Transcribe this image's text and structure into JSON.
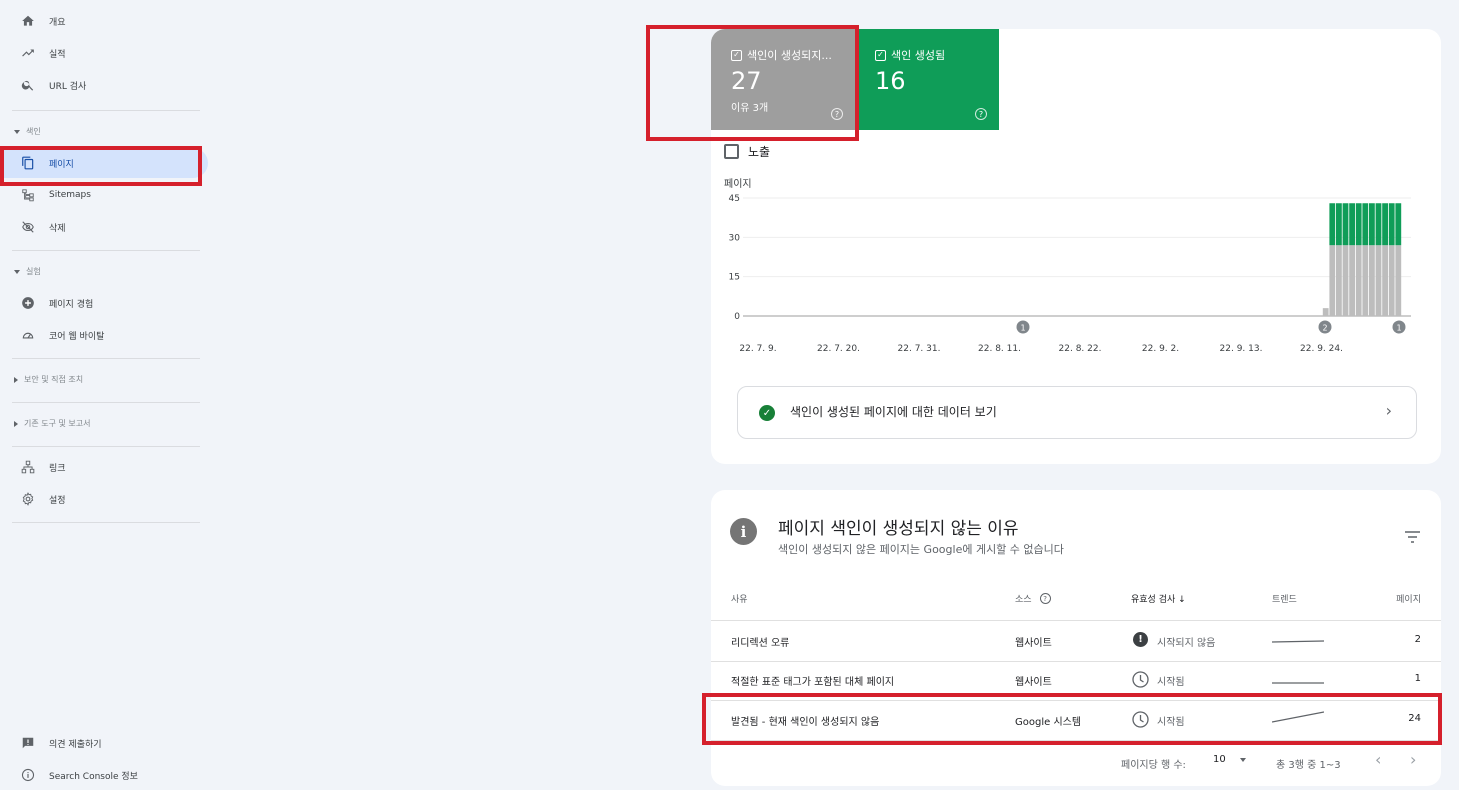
{
  "sidebar": {
    "items": [
      {
        "label": "개요",
        "icon": "home-icon"
      },
      {
        "label": "실적",
        "icon": "trending-up-icon"
      },
      {
        "label": "URL 검사",
        "icon": "search-icon"
      },
      {
        "label": "페이지",
        "icon": "pages-icon"
      },
      {
        "label": "Sitemaps",
        "icon": "sitemap-icon"
      },
      {
        "label": "삭제",
        "icon": "eye-off-icon"
      },
      {
        "label": "페이지 경험",
        "icon": "plus-circle-icon"
      },
      {
        "label": "코어 웹 바이탈",
        "icon": "speed-icon"
      },
      {
        "label": "링크",
        "icon": "links-icon"
      },
      {
        "label": "설정",
        "icon": "gear-icon"
      },
      {
        "label": "의견 제출하기",
        "icon": "feedback-icon"
      },
      {
        "label": "Search Console 정보",
        "icon": "info-icon"
      }
    ],
    "sections": [
      "색인",
      "실험",
      "보안 및 직접 조치",
      "기존 도구 및 보고서"
    ]
  },
  "tiles": {
    "not_indexed": {
      "label": "색인이 생성되지...",
      "count": "27",
      "sub": "이유 3개",
      "color": "#9e9e9e"
    },
    "indexed": {
      "label": "색인 생성됨",
      "count": "16",
      "color": "#0f9d58"
    }
  },
  "impressions_label": "노출",
  "chart_data": {
    "type": "bar",
    "ylabel": "페이지",
    "yticks": [
      "0",
      "15",
      "30",
      "45"
    ],
    "ylim": [
      0,
      45
    ],
    "x_tick_labels": [
      "22. 7. 9.",
      "22. 7. 20.",
      "22. 7. 31.",
      "22. 8. 11.",
      "22. 8. 22.",
      "22. 9. 2.",
      "22. 9. 13.",
      "22. 9. 24."
    ],
    "series": [
      {
        "values": [
          3,
          27,
          27,
          27,
          27,
          27,
          27,
          27,
          27,
          27,
          27,
          27
        ],
        "color": "#bdbdbd"
      },
      {
        "values": [
          0,
          16,
          16,
          16,
          16,
          16,
          16,
          16,
          16,
          16,
          16,
          16
        ],
        "color": "#0f9d58"
      }
    ],
    "annotations": [
      "1",
      "2",
      "1"
    ]
  },
  "view_indexed_link": "색인이 생성된 페이지에 대한 데이터 보기",
  "reasons": {
    "title": "페이지 색인이 생성되지 않는 이유",
    "subtitle": "색인이 생성되지 않은 페이지는 Google에 게시할 수 없습니다",
    "headers": {
      "reason": "사유",
      "source": "소스",
      "validation": "유효성 검사",
      "trend": "트렌드",
      "pages": "페이지"
    },
    "rows": [
      {
        "reason": "리디렉션 오류",
        "source": "웹사이트",
        "validation": "시작되지 않음",
        "pages": "2"
      },
      {
        "reason": "적절한 표준 태그가 포함된 대체 페이지",
        "source": "웹사이트",
        "validation": "시작됨",
        "pages": "1"
      },
      {
        "reason": "발견됨 - 현재 색인이 생성되지 않음",
        "source": "Google 시스템",
        "validation": "시작됨",
        "pages": "24"
      }
    ],
    "pagination": {
      "rows_per_page_label": "페이지당 행 수:",
      "rows_per_page": "10",
      "range": "총 3행 중 1~3"
    }
  }
}
